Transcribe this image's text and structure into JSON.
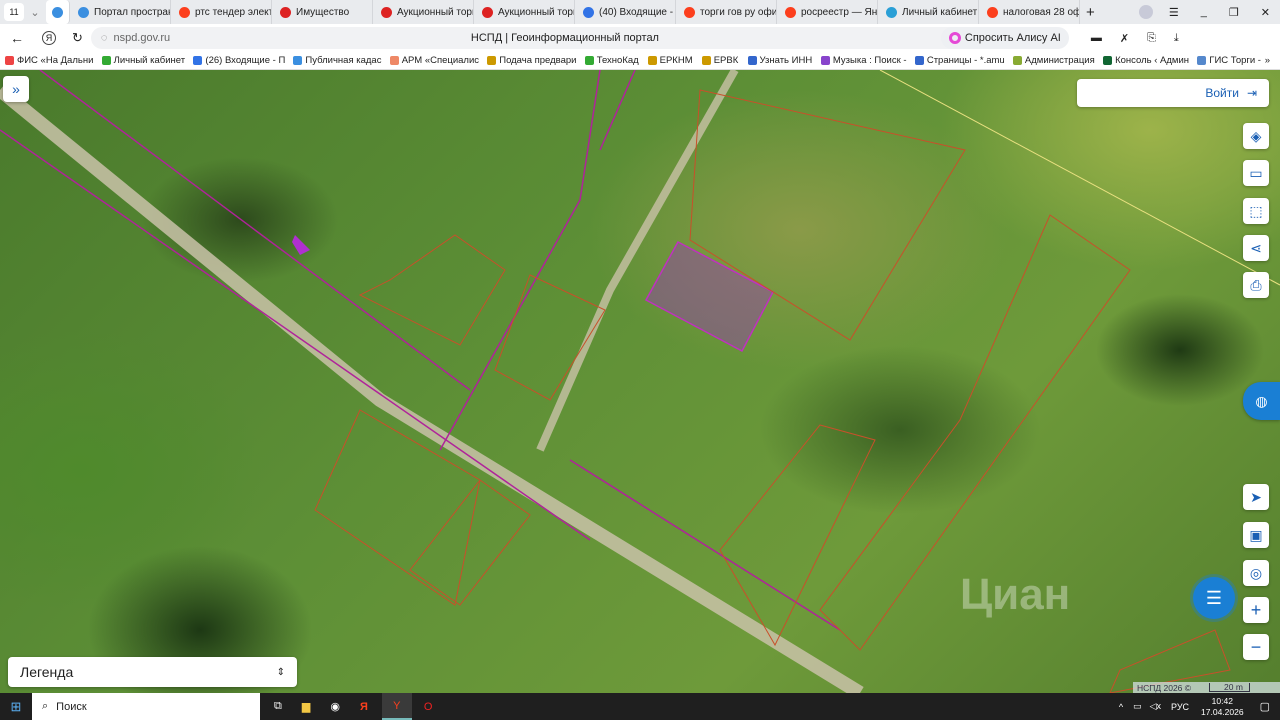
{
  "browser": {
    "tab_count": "11",
    "tabs": [
      {
        "label": "",
        "icon": "nspd-icon",
        "color": "#3b8fe0",
        "active": true
      },
      {
        "label": "Портал простран",
        "icon": "nspd-icon",
        "color": "#3b8fe0"
      },
      {
        "label": "ртс тендер элект",
        "icon": "yandex-icon",
        "color": "#fc3f1d"
      },
      {
        "label": "Имущество",
        "icon": "rts-icon",
        "color": "#d22"
      },
      {
        "label": "Аукционный торг",
        "icon": "rts-icon",
        "color": "#d22"
      },
      {
        "label": "Аукционный торг",
        "icon": "rts-icon",
        "color": "#d22"
      },
      {
        "label": "(40) Входящие - ",
        "icon": "mail-icon",
        "color": "#3273e6"
      },
      {
        "label": "торги гов ру офи",
        "icon": "yandex-icon",
        "color": "#fc3f1d"
      },
      {
        "label": "росреестр — Янд",
        "icon": "yandex-icon",
        "color": "#fc3f1d"
      },
      {
        "label": "Личный кабинет",
        "icon": "gov-icon",
        "color": "#2a9fd6"
      },
      {
        "label": "налоговая 28 офи",
        "icon": "yandex-icon",
        "color": "#fc3f1d"
      }
    ],
    "url": "nspd.gov.ru",
    "page_title": "НСПД | Геоинформационный портал",
    "alice_label": "Спросить Алису AI",
    "bookmarks": [
      {
        "label": "ФИС «На Дальни",
        "color": "#e44"
      },
      {
        "label": "Личный кабинет",
        "color": "#3a3"
      },
      {
        "label": "(26) Входящие - П",
        "color": "#3273e6"
      },
      {
        "label": "Публичная кадас",
        "color": "#3b8fe0"
      },
      {
        "label": "АРМ «Специалис",
        "color": "#e86"
      },
      {
        "label": "Подача предвари",
        "color": "#c90"
      },
      {
        "label": "ТехноКад",
        "color": "#3a3"
      },
      {
        "label": "ЕРКНМ",
        "color": "#c90"
      },
      {
        "label": "ЕРВК",
        "color": "#c90"
      },
      {
        "label": "Узнать ИНН",
        "color": "#36c"
      },
      {
        "label": "Музыка : Поиск - ",
        "color": "#84c"
      },
      {
        "label": "Страницы - *.amu",
        "color": "#36c"
      },
      {
        "label": "Администрация ",
        "color": "#8a3"
      },
      {
        "label": "Консоль ‹ Админ",
        "color": "#163"
      },
      {
        "label": "ГИС Торги - ",
        "color": "#58c"
      }
    ]
  },
  "map": {
    "login_label": "Войти",
    "legend_label": "Легенда",
    "attribution": "НСПД 2026 ©",
    "scale": "20 m",
    "watermark": "Циан"
  },
  "taskbar": {
    "search_placeholder": "Поиск",
    "language": "РУС",
    "time": "10:42",
    "date": "17.04.2026"
  }
}
